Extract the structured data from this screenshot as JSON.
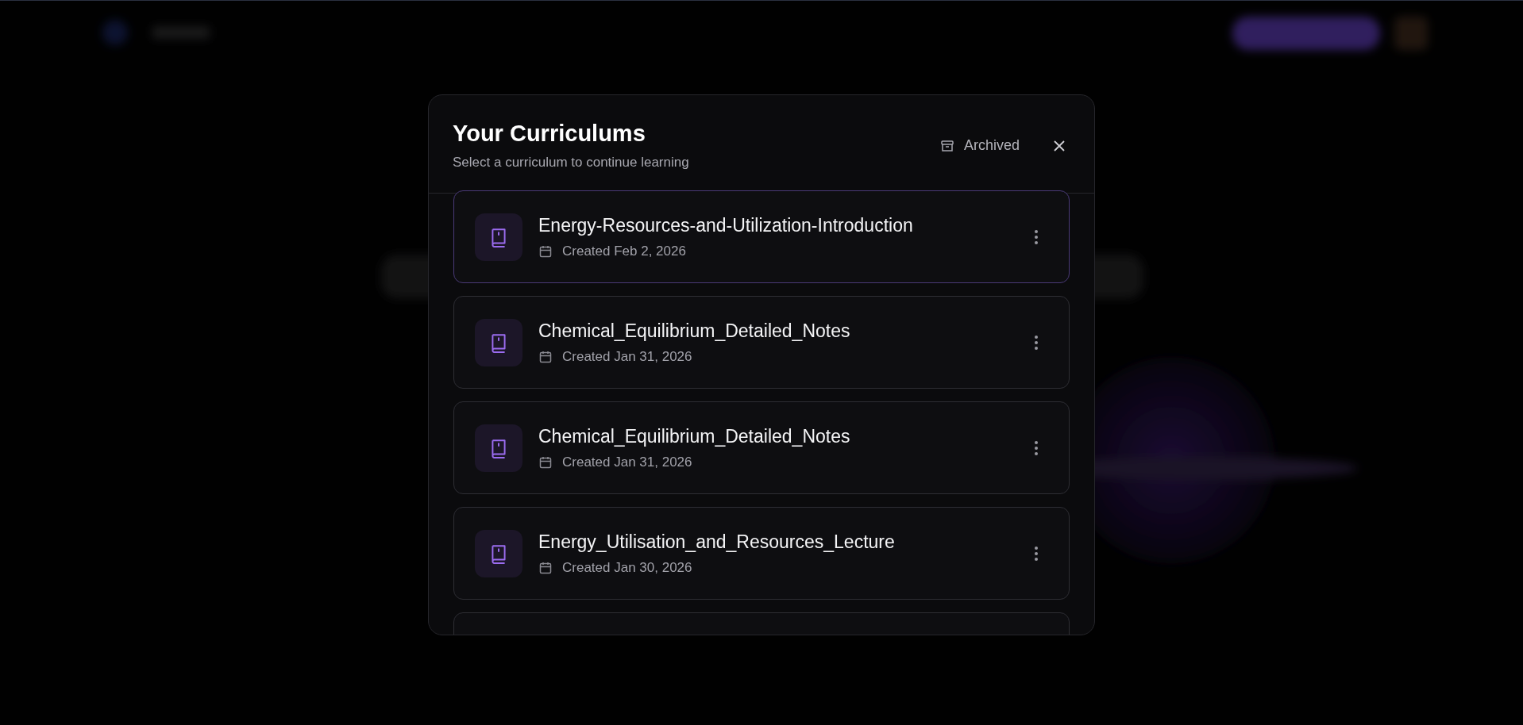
{
  "dialog": {
    "title": "Your Curriculums",
    "subtitle": "Select a curriculum to continue learning",
    "archived_button": "Archived"
  },
  "curriculums": [
    {
      "title": "Energy-Resources-and-Utilization-Introduction",
      "created": "Created Feb 2, 2026",
      "selected": true
    },
    {
      "title": "Chemical_Equilibrium_Detailed_Notes",
      "created": "Created Jan 31, 2026",
      "selected": false
    },
    {
      "title": "Chemical_Equilibrium_Detailed_Notes",
      "created": "Created Jan 31, 2026",
      "selected": false
    },
    {
      "title": "Energy_Utilisation_and_Resources_Lecture",
      "created": "Created Jan 30, 2026",
      "selected": false
    }
  ]
}
